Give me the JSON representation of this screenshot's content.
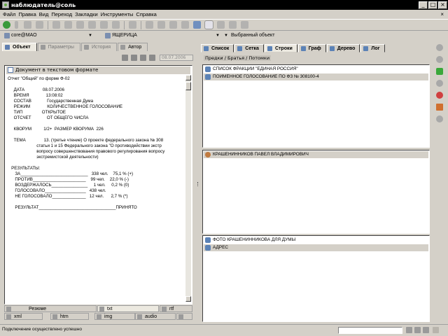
{
  "window": {
    "title": "наблюдатель@соль",
    "min_label": "_",
    "max_label": "□",
    "close_label": "×"
  },
  "menu": {
    "items": [
      "Файл",
      "Правка",
      "Вид",
      "Переход",
      "Закладки",
      "Инструменты",
      "Справка"
    ],
    "close_label": "×"
  },
  "address": {
    "user": "core@МАО",
    "category": "ЯЩЕРИЦА",
    "object": "Выбранный объект"
  },
  "left_tabs": [
    "Объект",
    "Параметры",
    "История",
    "Автор"
  ],
  "left_toolbar": {
    "date": "08.07.2006"
  },
  "doc": {
    "title": "Документ в текстовом формате",
    "lines": [
      "Отчет \"Общий\" по форме Ф-02",
      "",
      "     ДАТА               08.07.2006",
      "     ВРЕМЯ              13:08:02",
      "     СОСТАВ             Государственная Дума",
      "     РЕЖИМ              КОЛИЧЕСТВЕННОЕ ГОЛОСОВАНИЕ",
      "     ТИП                ОТКРЫТОЕ",
      "     ОТСЧЕТ             ОТ ОБЩЕГО ЧИСЛА",
      "",
      "     КВОРУМ          1/2+  РАЗМЕР КВОРУМА  226",
      "",
      "     ТЕМА               13. (третье чтение) О проекте федерального закона № 308",
      "                        статьи 1 и 15 Федерального закона \"О противодействии экстр",
      "                        вопросу совершенствования правового регулирования вопросу",
      "                        экстремистской деятельности)",
      "",
      "   РЕЗУЛЬТАТЫ:",
      "      ЗА____________________________   338 чел.    75,1 % (+)",
      "      ПРОТИВ______________________    99 чел.    22,0 % (-)",
      "      ВОЗДЕРЖАЛОСЬ_______________     1 чел.     0,2 % (0)",
      "      ГОЛОСОВАЛО_________________   438 чел.",
      "      НЕ ГОЛОСОВАЛО______________   12 чел.      2,7 % (*)",
      "",
      "      РЕЗУЛЬТАТ________________________________ПРИНЯТО"
    ]
  },
  "formats": {
    "row1": [
      "Резюме",
      "txt",
      "rtf"
    ],
    "row2": [
      "xml",
      "htm",
      "img",
      "audio"
    ]
  },
  "right_tabs": [
    "Список",
    "Сетка",
    "Строки",
    "Граф",
    "Дерево",
    "Лог"
  ],
  "breadcrumb": "Предки / Братья / Потомки",
  "top_items": [
    "СПИСОК ФРАКЦИИ \"ЕДИНАЯ РОССИЯ\"",
    "ПОИМЕННОЕ ГОЛОСОВАНИЕ ПО ФЗ № 308100-4"
  ],
  "middle_items": [
    "КРАШЕНИННИКОВ  ПАВЕЛ  ВЛАДИМИРОВИЧ"
  ],
  "bottom_items": [
    "ФОТО КРАШЕНИННИКОВА ДЛЯ ДУМЫ",
    "АДРЕС"
  ],
  "status": {
    "message": "Подключение осуществлено успешно"
  }
}
